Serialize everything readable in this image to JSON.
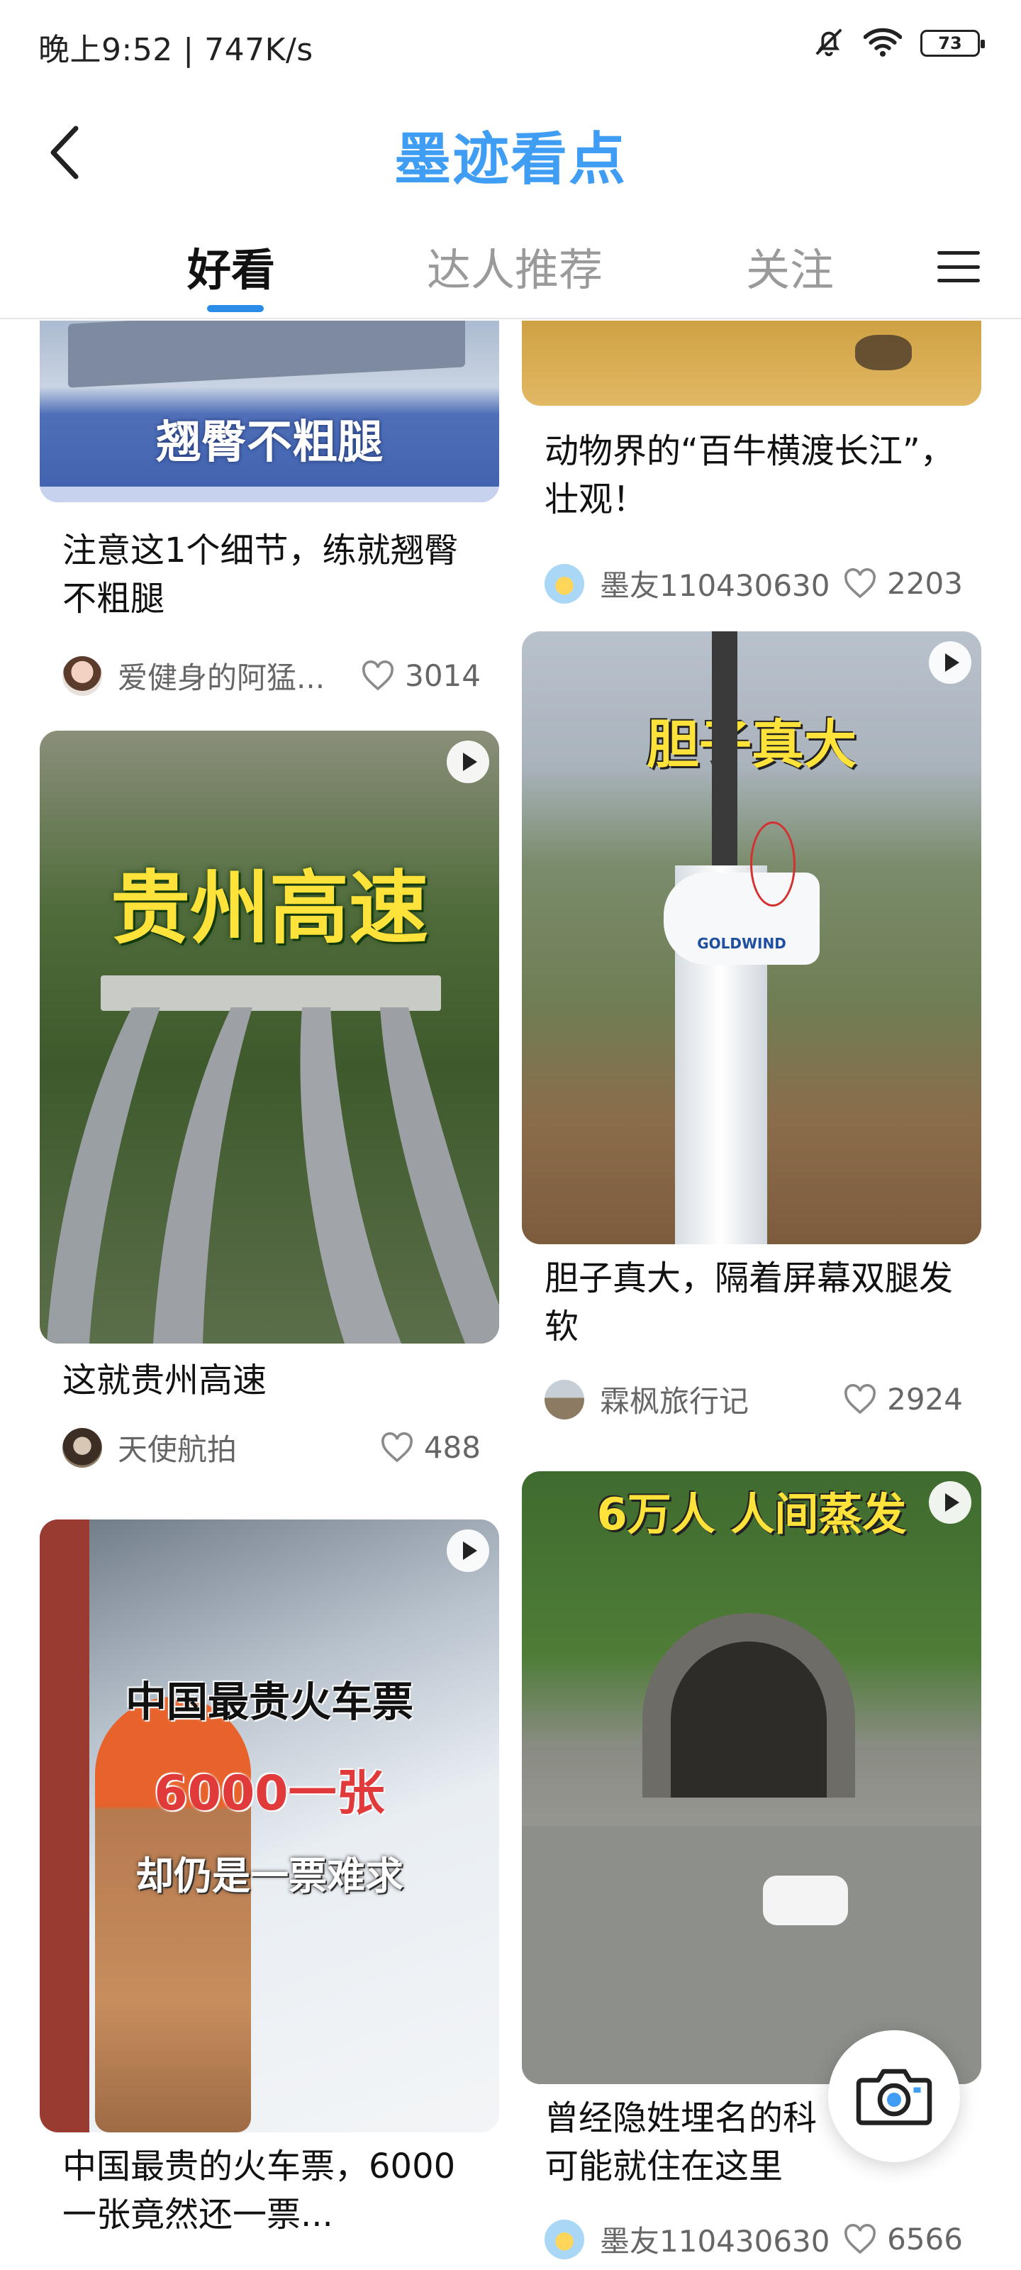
{
  "status_bar": {
    "time_speed": "晚上9:52 | 747K/s",
    "battery": "73"
  },
  "header": {
    "title": "墨迹看点"
  },
  "tabs": [
    {
      "label": "好看",
      "active": true
    },
    {
      "label": "达人推荐",
      "active": false
    },
    {
      "label": "关注",
      "active": false
    }
  ],
  "feed": {
    "left": [
      {
        "overlay": "翘臀不粗腿",
        "title": "注意这1个细节，练就翘臀不粗腿",
        "author": "爱健身的阿猛...",
        "likes": "3014",
        "video": false
      },
      {
        "overlay": "贵州高速",
        "title": "这就贵州高速",
        "author": "天使航拍",
        "likes": "488",
        "video": true
      },
      {
        "overlay_lines": [
          "中国最贵火车票",
          "6000一张",
          "却仍是一票难求"
        ],
        "title": "中国最贵的火车票，6000一张竟然还一票...",
        "video": true
      }
    ],
    "right": [
      {
        "title": "动物界的“百牛横渡长江”，壮观！",
        "author": "墨友110430630",
        "likes": "2203",
        "video": false
      },
      {
        "overlay": "胆子真大",
        "brand": "GOLDWIND",
        "title": "胆子真大，隔着屏幕双腿发软",
        "author": "霖枫旅行记",
        "likes": "2924",
        "video": true
      },
      {
        "overlay": "6万人 人间蒸发",
        "title": "曾经隐姓埋名的科...可能就住在这里",
        "title_line1": "曾经隐姓埋名的科",
        "title_line2": "可能就住在这里",
        "author": "墨友110430630",
        "likes": "6566",
        "video": true
      }
    ]
  },
  "colors": {
    "brand_blue": "#3f9ef3",
    "tab_indicator": "#2c8de8",
    "overlay_yellow": "#ffe23a"
  },
  "icons": [
    "back-arrow-icon",
    "mute-bell-icon",
    "wifi-icon",
    "battery-icon",
    "menu-icon",
    "play-icon",
    "heart-icon",
    "camera-icon"
  ]
}
